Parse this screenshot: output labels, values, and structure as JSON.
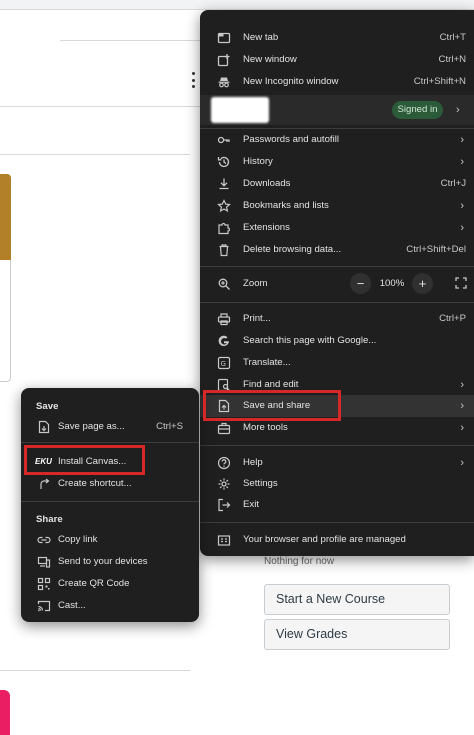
{
  "main_menu": {
    "items_top": [
      {
        "icon": "new-tab-icon",
        "label": "New tab",
        "shortcut": "Ctrl+T"
      },
      {
        "icon": "new-window-icon",
        "label": "New window",
        "shortcut": "Ctrl+N"
      },
      {
        "icon": "incognito-icon",
        "label": "New Incognito window",
        "shortcut": "Ctrl+Shift+N"
      }
    ],
    "profile": {
      "status": "Signed in"
    },
    "items_mid": [
      {
        "icon": "key-icon",
        "label": "Passwords and autofill",
        "submenu": true
      },
      {
        "icon": "history-icon",
        "label": "History",
        "submenu": true
      },
      {
        "icon": "download-icon",
        "label": "Downloads",
        "shortcut": "Ctrl+J"
      },
      {
        "icon": "star-icon",
        "label": "Bookmarks and lists",
        "submenu": true
      },
      {
        "icon": "extensions-icon",
        "label": "Extensions",
        "submenu": true
      },
      {
        "icon": "trash-icon",
        "label": "Delete browsing data...",
        "shortcut": "Ctrl+Shift+Del"
      }
    ],
    "zoom": {
      "label": "Zoom",
      "minus": "−",
      "value": "100%",
      "plus": "+"
    },
    "items_tools": [
      {
        "icon": "print-icon",
        "label": "Print...",
        "shortcut": "Ctrl+P"
      },
      {
        "icon": "google-icon",
        "label": "Search this page with Google..."
      },
      {
        "icon": "translate-icon",
        "label": "Translate..."
      },
      {
        "icon": "find-icon",
        "label": "Find and edit",
        "submenu": true
      },
      {
        "icon": "save-share-icon",
        "label": "Save and share",
        "submenu": true
      },
      {
        "icon": "toolbox-icon",
        "label": "More tools",
        "submenu": true
      }
    ],
    "items_bottom": [
      {
        "icon": "help-icon",
        "label": "Help",
        "submenu": true
      },
      {
        "icon": "settings-icon",
        "label": "Settings"
      },
      {
        "icon": "exit-icon",
        "label": "Exit"
      }
    ],
    "managed": {
      "icon": "managed-icon",
      "label": "Your browser and profile are managed"
    }
  },
  "sub_menu": {
    "save_heading": "Save",
    "save_items": [
      {
        "icon": "save-page-icon",
        "label": "Save page as...",
        "shortcut": "Ctrl+S"
      },
      {
        "icon": "eku-app-icon",
        "icon_text": "EKU",
        "label": "Install Canvas..."
      },
      {
        "icon": "shortcut-icon",
        "label": "Create shortcut..."
      }
    ],
    "share_heading": "Share",
    "share_items": [
      {
        "icon": "link-icon",
        "label": "Copy link"
      },
      {
        "icon": "send-devices-icon",
        "label": "Send to your devices"
      },
      {
        "icon": "qr-code-icon",
        "label": "Create QR Code"
      },
      {
        "icon": "cast-icon",
        "label": "Cast..."
      }
    ]
  },
  "page": {
    "nothing_text": "Nothing for now",
    "buttons": [
      "Start a New Course",
      "View Grades"
    ]
  },
  "colors": {
    "menu_bg": "#1f1f1f",
    "highlight_box": "#d62828",
    "signed_in_pill": "#2c5b3a"
  }
}
